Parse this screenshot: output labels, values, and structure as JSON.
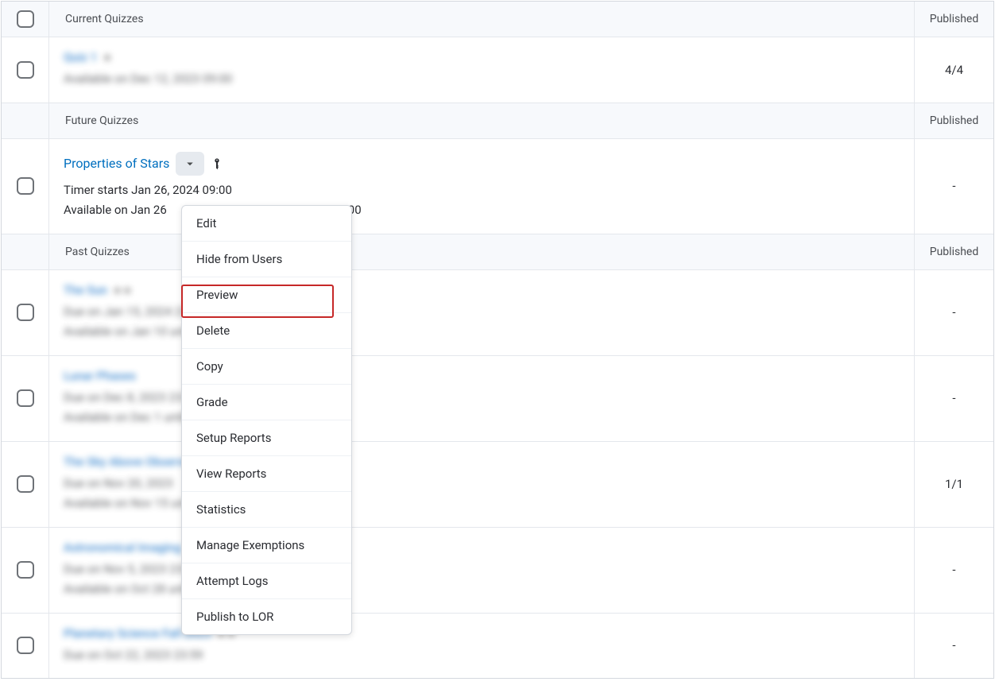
{
  "sections": {
    "current": {
      "title": "Current Quizzes",
      "status_header": "Published"
    },
    "future": {
      "title": "Future Quizzes",
      "status_header": "Published"
    },
    "past": {
      "title": "Past Quizzes",
      "status_header": "Published"
    }
  },
  "quiz_current": {
    "title_placeholder": "Quiz 1",
    "meta_placeholder": "Available on Dec 12, 2023 09:00",
    "status": "4/4"
  },
  "quiz_future": {
    "title": "Properties of Stars",
    "line1": "Timer starts Jan 26, 2024 09:00",
    "line2_part1": "Available on Jan 26",
    "line2_part2": "18:00",
    "status": "-"
  },
  "past_quizzes": [
    {
      "title_ph": "The Sun",
      "meta1_ph": "Due on Jan 15, 2024 23:59",
      "meta2_ph": "Available on Jan 10 until Jan 20, 2024",
      "status": "-"
    },
    {
      "title_ph": "Lunar Phases",
      "meta1_ph": "Due on Dec 8, 2023 23:59",
      "meta2_ph": "Available on Dec 1 until Dec 10, 2023",
      "status": "-"
    },
    {
      "title_ph": "The Sky Above Observer",
      "meta1_ph": "Due on Nov 20, 2023",
      "meta2_ph": "Available on Nov 15 until Nov 25",
      "status": "1/1"
    },
    {
      "title_ph": "Astronomical Imaging",
      "meta1_ph": "Due on Nov 5, 2023 23:59",
      "meta2_ph": "Available on Oct 28 until Nov 10, 2023",
      "status": "-"
    },
    {
      "title_ph": "Planetary Science Fall 2023",
      "meta1_ph": "Due on Oct 22, 2023 23:59",
      "meta2_ph": "",
      "status": "-"
    }
  ],
  "dropdown": {
    "items": [
      "Edit",
      "Hide from Users",
      "Preview",
      "Delete",
      "Copy",
      "Grade",
      "Setup Reports",
      "View Reports",
      "Statistics",
      "Manage Exemptions",
      "Attempt Logs",
      "Publish to LOR"
    ]
  }
}
